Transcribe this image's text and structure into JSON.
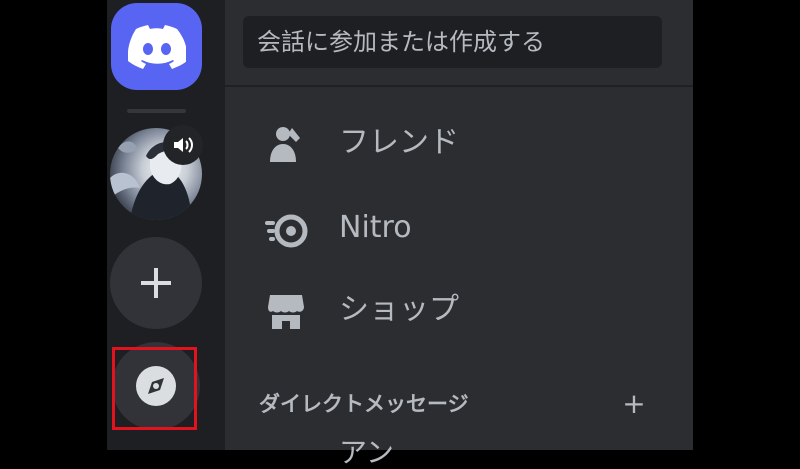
{
  "search": {
    "placeholder": "会話に参加または作成する"
  },
  "nav": {
    "items": [
      {
        "label": "フレンド",
        "icon": "friends-icon"
      },
      {
        "label": "Nitro",
        "icon": "nitro-icon"
      },
      {
        "label": "ショップ",
        "icon": "shop-icon"
      }
    ]
  },
  "direct_messages": {
    "header": "ダイレクトメッセージ",
    "add_label": "+",
    "partial_item": "アン"
  },
  "rail": {
    "add_label": "+"
  },
  "colors": {
    "brand": "#5865f2",
    "rail_bg": "#1e1f22",
    "panel_bg": "#2b2d31",
    "highlight": "#e0131f"
  }
}
